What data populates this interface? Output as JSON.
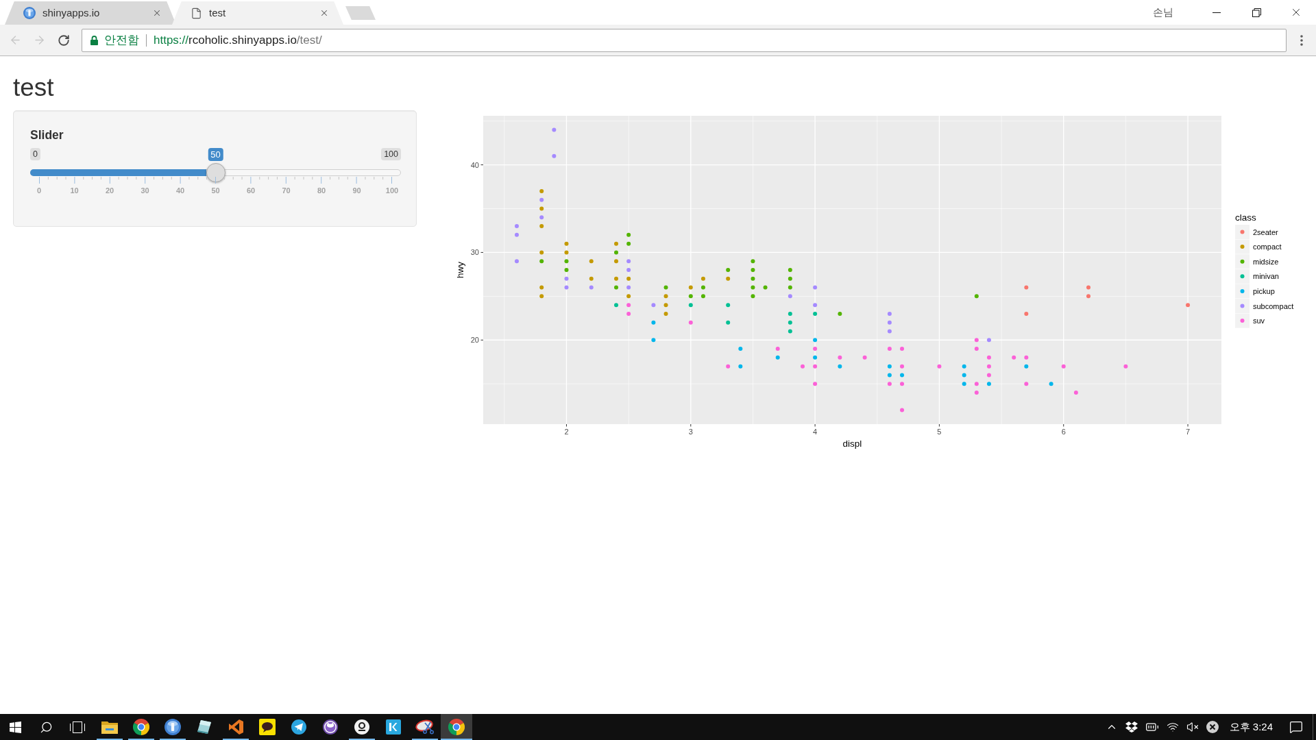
{
  "browser": {
    "tabs": [
      {
        "kind": "app",
        "title": "shinyapps.io",
        "selected": false
      },
      {
        "kind": "page",
        "title": "test",
        "selected": true
      }
    ],
    "profile": "손님",
    "back": {
      "disabled": true
    },
    "forward": {
      "disabled": true
    },
    "address": {
      "secure": true,
      "security_label": "안전함",
      "scheme": "https://",
      "host": "rcoholic.shinyapps.io",
      "path": "/test/"
    }
  },
  "page": {
    "title": "test",
    "slider": {
      "label": "Slider",
      "min_label": "0",
      "max_label": "100",
      "value_label": "50",
      "level": 0.5,
      "ticks": [
        "0",
        "10",
        "20",
        "30",
        "40",
        "50",
        "60",
        "70",
        "80",
        "90",
        "100"
      ]
    },
    "plot": {
      "chart_data": {
        "type": "scatter",
        "xlabel": "displ",
        "ylabel": "hwy",
        "legend_title": "class",
        "legend": "right",
        "grid": true,
        "xlim": [
          1.33,
          7.27
        ],
        "ylim": [
          10.4,
          45.6
        ],
        "xticks": [
          2,
          3,
          4,
          5,
          6,
          7
        ],
        "yticks": [
          20,
          30,
          40
        ],
        "series": [
          {
            "name": "2seater",
            "color": "#f8766d",
            "x": [
              5.7,
              5.7,
              6.2,
              6.2,
              7.0
            ],
            "values": [
              26,
              23,
              26,
              25,
              24
            ]
          },
          {
            "name": "compact",
            "color": "#c49a00",
            "x": [
              1.8,
              1.8,
              1.8,
              1.8,
              1.8,
              1.8,
              2.0,
              2.0,
              2.2,
              2.2,
              2.4,
              2.4,
              2.4,
              2.5,
              2.5,
              2.8,
              2.8,
              2.8,
              3.0,
              3.1,
              3.3
            ],
            "values": [
              37,
              35,
              33,
              30,
              26,
              25,
              31,
              30,
              29,
              27,
              31,
              29,
              27,
              27,
              25,
              25,
              24,
              23,
              26,
              27,
              27
            ]
          },
          {
            "name": "midsize",
            "color": "#53b400",
            "x": [
              1.8,
              2.0,
              2.0,
              2.4,
              2.4,
              2.5,
              2.5,
              2.8,
              3.0,
              3.1,
              3.1,
              3.3,
              3.5,
              3.5,
              3.5,
              3.5,
              3.5,
              3.6,
              3.8,
              3.8,
              3.8,
              4.2,
              5.3
            ],
            "values": [
              29,
              29,
              28,
              30,
              26,
              32,
              31,
              26,
              25,
              26,
              25,
              28,
              29,
              28,
              27,
              26,
              25,
              26,
              28,
              27,
              26,
              23,
              25
            ]
          },
          {
            "name": "minivan",
            "color": "#00c094",
            "x": [
              2.4,
              3.0,
              3.3,
              3.3,
              3.8,
              3.8,
              3.8,
              4.0
            ],
            "values": [
              24,
              24,
              24,
              22,
              23,
              22,
              21,
              23
            ]
          },
          {
            "name": "pickup",
            "color": "#00b6eb",
            "x": [
              2.7,
              2.7,
              3.4,
              3.4,
              3.7,
              4.0,
              4.0,
              4.2,
              4.6,
              4.6,
              4.7,
              5.2,
              5.2,
              5.2,
              5.4,
              5.7,
              5.9
            ],
            "values": [
              22,
              20,
              19,
              17,
              18,
              20,
              18,
              17,
              17,
              16,
              16,
              17,
              16,
              15,
              15,
              17,
              15
            ]
          },
          {
            "name": "subcompact",
            "color": "#a58aff",
            "x": [
              1.6,
              1.6,
              1.6,
              1.8,
              1.8,
              1.9,
              1.9,
              2.0,
              2.0,
              2.2,
              2.5,
              2.5,
              2.5,
              2.7,
              3.8,
              4.0,
              4.0,
              4.6,
              4.6,
              4.6,
              5.4
            ],
            "values": [
              33,
              32,
              29,
              36,
              34,
              44,
              41,
              27,
              26,
              26,
              29,
              28,
              26,
              24,
              25,
              26,
              24,
              23,
              22,
              21,
              20
            ]
          },
          {
            "name": "suv",
            "color": "#fb61d7",
            "x": [
              2.5,
              2.5,
              3.0,
              3.3,
              3.7,
              3.9,
              4.0,
              4.0,
              4.0,
              4.2,
              4.4,
              4.6,
              4.6,
              4.7,
              4.7,
              4.7,
              4.7,
              5.0,
              5.3,
              5.3,
              5.3,
              5.3,
              5.4,
              5.4,
              5.4,
              5.6,
              5.7,
              5.7,
              6.0,
              6.1,
              6.5
            ],
            "values": [
              24,
              23,
              22,
              17,
              19,
              17,
              19,
              17,
              15,
              18,
              18,
              19,
              15,
              19,
              17,
              15,
              12,
              17,
              20,
              19,
              15,
              14,
              18,
              17,
              16,
              18,
              18,
              15,
              17,
              14,
              17
            ]
          }
        ]
      }
    }
  },
  "taskbar": {
    "apps": [
      {
        "kind": "folder",
        "running": true,
        "selected": false
      },
      {
        "kind": "browser",
        "running": true,
        "selected": false
      },
      {
        "kind": "rlogo",
        "running": true,
        "selected": false
      },
      {
        "kind": "pane",
        "running": false,
        "selected": false
      },
      {
        "kind": "ribbon",
        "running": true,
        "selected": false
      },
      {
        "kind": "chat",
        "running": false,
        "selected": false
      },
      {
        "kind": "plane",
        "running": false,
        "selected": false
      },
      {
        "kind": "cat",
        "running": false,
        "selected": false
      },
      {
        "kind": "ring",
        "running": true,
        "selected": false
      },
      {
        "kind": "tile",
        "running": false,
        "selected": false
      },
      {
        "kind": "scissors",
        "running": true,
        "selected": false
      },
      {
        "kind": "browser",
        "running": true,
        "selected": true
      }
    ],
    "clock": "오후 3:24"
  }
}
